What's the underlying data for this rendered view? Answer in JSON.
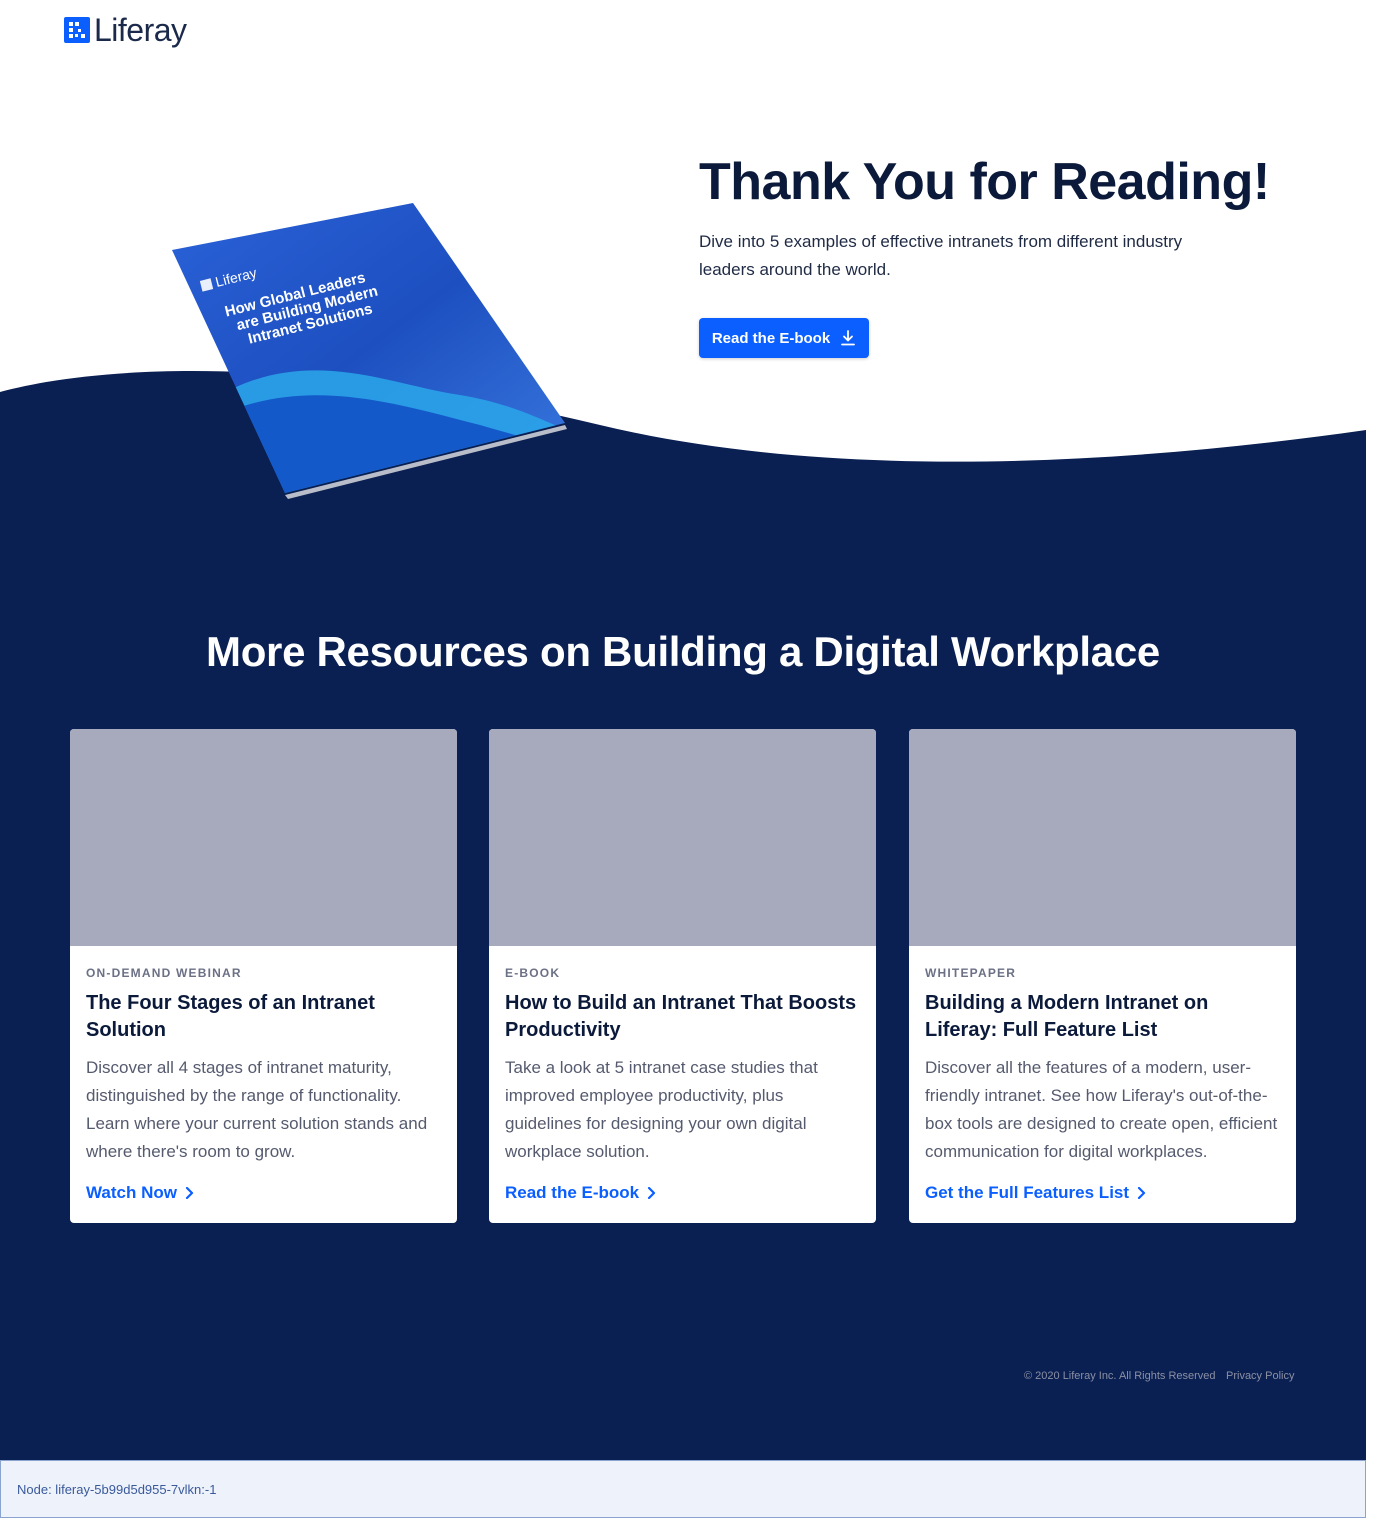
{
  "header": {
    "logo_text": "Liferay",
    "logo_icon": "liferay-logo-icon"
  },
  "hero": {
    "title": "Thank You for Reading!",
    "description": "Dive into 5 examples of effective intranets from different industry leaders around the world.",
    "button_label": "Read the E-book",
    "button_icon": "download-icon",
    "book_cover": {
      "brand": "Liferay",
      "title_lines": [
        "How Global Leaders",
        "are Building Modern",
        "Intranet Solutions"
      ]
    }
  },
  "resources": {
    "title": "More Resources on Building a Digital Workplace",
    "cards": [
      {
        "type": "ON-DEMAND WEBINAR",
        "title": "The Four Stages of an Intranet Solution",
        "description": "Discover all 4 stages of intranet maturity, distinguished by the range of functionality. Learn where your current solution stands and where there's room to grow.",
        "link": "Watch Now"
      },
      {
        "type": "E-BOOK",
        "title": "How to Build an Intranet That Boosts Productivity",
        "description": "Take a look at 5 intranet case studies that improved employee productivity, plus guidelines for designing your own digital workplace solution.",
        "link": "Read the E-book"
      },
      {
        "type": "WHITEPAPER",
        "title": "Building a Modern Intranet on Liferay: Full Feature List",
        "description": "Discover all the features of a modern, user-friendly intranet. See how Liferay's out-of-the-box tools are designed to create open, efficient communication for digital workplaces.",
        "link": "Get the Full Features List"
      }
    ]
  },
  "footer": {
    "copyright": "© 2020 Liferay Inc. All Rights Reserved",
    "privacy": "Privacy Policy"
  },
  "node_bar": {
    "text": "Node: liferay-5b99d5d955-7vlkn:-1"
  },
  "colors": {
    "navy": "#0a1f52",
    "accent_blue": "#0b5fff",
    "card_image_placeholder": "#a7aabc",
    "text_dark": "#0b1a3a"
  }
}
